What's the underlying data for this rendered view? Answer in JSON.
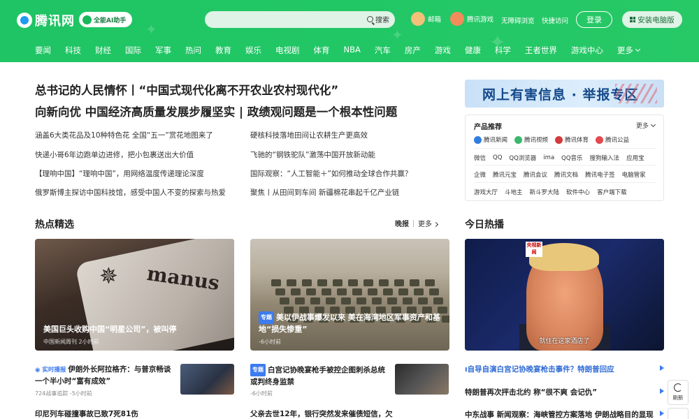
{
  "header": {
    "logo": "腾讯网",
    "ai_assistant": "全能AI助手",
    "search_placeholder": "",
    "search_button": "搜索",
    "links": [
      "邮箱",
      "腾讯游戏",
      "无障碍浏览",
      "快捷访问"
    ],
    "login": "登录",
    "install": "安装电脑版"
  },
  "nav": [
    "要闻",
    "科技",
    "财经",
    "国际",
    "军事",
    "热问",
    "教育",
    "娱乐",
    "电视剧",
    "体育",
    "NBA",
    "汽车",
    "房产",
    "游戏",
    "健康",
    "科学",
    "王者世界",
    "游戏中心"
  ],
  "nav_more": "更多",
  "headlines": {
    "main1": "总书记的人民情怀丨“中国式现代化离不开农业农村现代化”",
    "main2": "向新向优 中国经济高质量发展步履坚实 | 政绩观问题是一个根本性问题",
    "left": [
      "涵盖6大类花品及10种特色花 全国“五一”赏花地图来了",
      "快递小哥6年边跑单边进修，把小包裹送出大价值",
      "【理响中国】“理响中国”，用网络温度传递理论深度",
      "俄罗斯博主探访中国科技馆，感受中国人不变的探索与热爱"
    ],
    "right": [
      "硬核科技落地田间让农耕生产更高效",
      "飞驰的“钢铁驼队”激荡中国开放新动能",
      "国际观察：“人工智能＋”如何推动全球合作共赢？",
      "聚焦丨从田间到车间 新疆棉花串起千亿产业链"
    ]
  },
  "sidebar": {
    "report_banner": "网上有害信息 · 举报专区",
    "products_title": "产品推荐",
    "products_more": "更多",
    "row1": [
      "腾讯新闻",
      "腾讯视频",
      "腾讯体育",
      "腾讯公益"
    ],
    "row2": [
      "微信",
      "QQ",
      "QQ浏览器",
      "ima",
      "QQ音乐",
      "搜狗输入法",
      "应用宝"
    ],
    "row3": [
      "企微",
      "腾讯元宝",
      "腾讯会议",
      "腾讯文档",
      "腾讯电子签",
      "电脑管家"
    ],
    "row4": [
      "游戏大厅",
      "斗地主",
      "新斗罗大陆",
      "软件中心",
      "客户端下载"
    ]
  },
  "hot": {
    "title": "热点精选",
    "kuaibao": "晚报",
    "more": "更多",
    "card1": {
      "caption": "美国巨头收购中国“明星公司”，被叫停",
      "meta": "中国新闻周刊 2小时前",
      "overlay": "manus"
    },
    "card2": {
      "tag": "专题",
      "caption": "美以伊战事爆发以来 美在海湾地区军事资产和基地“损失惨重”",
      "meta": "-6小时前"
    },
    "list1": {
      "live": "实时播报",
      "title": "伊朗外长阿拉格齐：与普京畅谈一个半小时“富有成效”",
      "meta": "724战事追踪 -5小时前"
    },
    "list2": {
      "tag": "专题",
      "title": "白宫记协晚宴枪手被控企图刺杀总统 或判终身监禁",
      "meta": "-6小时前"
    },
    "list3": "印尼列车碰撞事故已致7死81伤",
    "list4": "父亲去世12年，银行突然发来催债短信，欠"
  },
  "today": {
    "title": "今日热播",
    "tv_logo": "央视新闻",
    "subtitle": "就住在这家酒店了",
    "lines": [
      "自导自演白宫记协晚宴枪击事件？特朗普回应",
      "特朗普再次抨击北约 称“很不爽 会记仇”",
      "中东战事 新闻观察：海峡管控方案落地 伊朗战略目的显现"
    ]
  },
  "refresh": "刷新",
  "colors": {
    "brand_green": "#22c765",
    "link_blue": "#2f6bd6"
  }
}
